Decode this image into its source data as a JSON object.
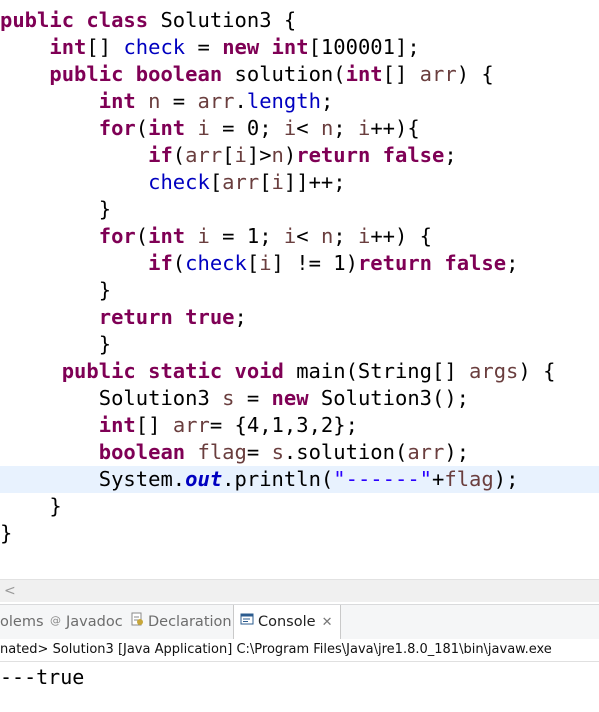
{
  "editor": {
    "lines": [
      [
        {
          "t": "public class ",
          "c": "kw"
        },
        {
          "t": "Solution3 {",
          "c": "plain"
        }
      ],
      [
        {
          "t": "    ",
          "c": "plain"
        },
        {
          "t": "int",
          "c": "kw"
        },
        {
          "t": "[] ",
          "c": "plain"
        },
        {
          "t": "check",
          "c": "fld"
        },
        {
          "t": " = ",
          "c": "plain"
        },
        {
          "t": "new int",
          "c": "kw"
        },
        {
          "t": "[100001];",
          "c": "plain"
        }
      ],
      [
        {
          "t": "    ",
          "c": "plain"
        },
        {
          "t": "public boolean ",
          "c": "kw"
        },
        {
          "t": "solution(",
          "c": "plain"
        },
        {
          "t": "int",
          "c": "kw"
        },
        {
          "t": "[] ",
          "c": "plain"
        },
        {
          "t": "arr",
          "c": "var"
        },
        {
          "t": ") {",
          "c": "plain"
        }
      ],
      [
        {
          "t": "        ",
          "c": "plain"
        },
        {
          "t": "int ",
          "c": "kw"
        },
        {
          "t": "n",
          "c": "var"
        },
        {
          "t": " = ",
          "c": "plain"
        },
        {
          "t": "arr",
          "c": "var"
        },
        {
          "t": ".",
          "c": "plain"
        },
        {
          "t": "length",
          "c": "fld"
        },
        {
          "t": ";",
          "c": "plain"
        }
      ],
      [
        {
          "t": "        ",
          "c": "plain"
        },
        {
          "t": "for",
          "c": "kw"
        },
        {
          "t": "(",
          "c": "plain"
        },
        {
          "t": "int ",
          "c": "kw"
        },
        {
          "t": "i",
          "c": "var"
        },
        {
          "t": " = 0; ",
          "c": "plain"
        },
        {
          "t": "i",
          "c": "var"
        },
        {
          "t": "< ",
          "c": "plain"
        },
        {
          "t": "n",
          "c": "var"
        },
        {
          "t": "; ",
          "c": "plain"
        },
        {
          "t": "i",
          "c": "var"
        },
        {
          "t": "++){",
          "c": "plain"
        }
      ],
      [
        {
          "t": "            ",
          "c": "plain"
        },
        {
          "t": "if",
          "c": "kw"
        },
        {
          "t": "(",
          "c": "plain"
        },
        {
          "t": "arr",
          "c": "var"
        },
        {
          "t": "[",
          "c": "plain"
        },
        {
          "t": "i",
          "c": "var"
        },
        {
          "t": "]>",
          "c": "plain"
        },
        {
          "t": "n",
          "c": "var"
        },
        {
          "t": ")",
          "c": "plain"
        },
        {
          "t": "return false",
          "c": "kw"
        },
        {
          "t": ";",
          "c": "plain"
        }
      ],
      [
        {
          "t": "            ",
          "c": "plain"
        },
        {
          "t": "check",
          "c": "fld"
        },
        {
          "t": "[",
          "c": "plain"
        },
        {
          "t": "arr",
          "c": "var"
        },
        {
          "t": "[",
          "c": "plain"
        },
        {
          "t": "i",
          "c": "var"
        },
        {
          "t": "]]++;",
          "c": "plain"
        }
      ],
      [
        {
          "t": "        }",
          "c": "plain"
        }
      ],
      [
        {
          "t": "        ",
          "c": "plain"
        },
        {
          "t": "for",
          "c": "kw"
        },
        {
          "t": "(",
          "c": "plain"
        },
        {
          "t": "int ",
          "c": "kw"
        },
        {
          "t": "i",
          "c": "var"
        },
        {
          "t": " = 1; ",
          "c": "plain"
        },
        {
          "t": "i",
          "c": "var"
        },
        {
          "t": "< ",
          "c": "plain"
        },
        {
          "t": "n",
          "c": "var"
        },
        {
          "t": "; ",
          "c": "plain"
        },
        {
          "t": "i",
          "c": "var"
        },
        {
          "t": "++) {",
          "c": "plain"
        }
      ],
      [
        {
          "t": "            ",
          "c": "plain"
        },
        {
          "t": "if",
          "c": "kw"
        },
        {
          "t": "(",
          "c": "plain"
        },
        {
          "t": "check",
          "c": "fld"
        },
        {
          "t": "[",
          "c": "plain"
        },
        {
          "t": "i",
          "c": "var"
        },
        {
          "t": "] != 1)",
          "c": "plain"
        },
        {
          "t": "return false",
          "c": "kw"
        },
        {
          "t": ";",
          "c": "plain"
        }
      ],
      [
        {
          "t": "        }",
          "c": "plain"
        }
      ],
      [
        {
          "t": "        ",
          "c": "plain"
        },
        {
          "t": "return true",
          "c": "kw"
        },
        {
          "t": ";",
          "c": "plain"
        }
      ],
      [
        {
          "t": "        }",
          "c": "plain"
        }
      ],
      [
        {
          "t": "     ",
          "c": "plain"
        },
        {
          "t": "public static void ",
          "c": "kw"
        },
        {
          "t": "main(String[] ",
          "c": "plain"
        },
        {
          "t": "args",
          "c": "var"
        },
        {
          "t": ") {",
          "c": "plain"
        }
      ],
      [
        {
          "t": "        Solution3 ",
          "c": "plain"
        },
        {
          "t": "s",
          "c": "var"
        },
        {
          "t": " = ",
          "c": "plain"
        },
        {
          "t": "new ",
          "c": "kw"
        },
        {
          "t": "Solution3();",
          "c": "plain"
        }
      ],
      [
        {
          "t": "        ",
          "c": "plain"
        },
        {
          "t": "int",
          "c": "kw"
        },
        {
          "t": "[] ",
          "c": "plain"
        },
        {
          "t": "arr",
          "c": "var"
        },
        {
          "t": "= {4,1,3,2};",
          "c": "plain"
        }
      ],
      [
        {
          "t": "        ",
          "c": "plain"
        },
        {
          "t": "boolean ",
          "c": "kw"
        },
        {
          "t": "flag",
          "c": "var"
        },
        {
          "t": "= ",
          "c": "plain"
        },
        {
          "t": "s",
          "c": "var"
        },
        {
          "t": ".solution(",
          "c": "plain"
        },
        {
          "t": "arr",
          "c": "var"
        },
        {
          "t": ");",
          "c": "plain"
        }
      ],
      [
        {
          "t": "        System.",
          "c": "plain"
        },
        {
          "t": "out",
          "c": "static-fld"
        },
        {
          "t": ".println(",
          "c": "plain"
        },
        {
          "t": "\"------\"",
          "c": "str"
        },
        {
          "t": "+",
          "c": "plain"
        },
        {
          "t": "flag",
          "c": "var"
        },
        {
          "t": ");",
          "c": "plain"
        }
      ],
      [
        {
          "t": "    }",
          "c": "plain"
        }
      ],
      [
        {
          "t": "}",
          "c": "plain"
        }
      ]
    ],
    "current_line_index": 17
  },
  "scrollbar": {
    "left_arrow": "<"
  },
  "tabs": [
    {
      "label": "olems",
      "icon": "problems-icon",
      "active": false
    },
    {
      "label": "Javadoc",
      "icon": "at-icon",
      "active": false
    },
    {
      "label": "Declaration",
      "icon": "declaration-icon",
      "active": false
    },
    {
      "label": "Console",
      "icon": "console-icon",
      "active": true,
      "close": "✕"
    }
  ],
  "console": {
    "header": "nated> Solution3 [Java Application] C:\\Program Files\\Java\\jre1.8.0_181\\bin\\javaw.exe",
    "output": "---true"
  },
  "colors": {
    "keyword": "#7f0055",
    "field": "#0000c0",
    "local_var": "#6a3e3e",
    "string": "#2a00ff",
    "current_line": "#e8f2fe"
  }
}
